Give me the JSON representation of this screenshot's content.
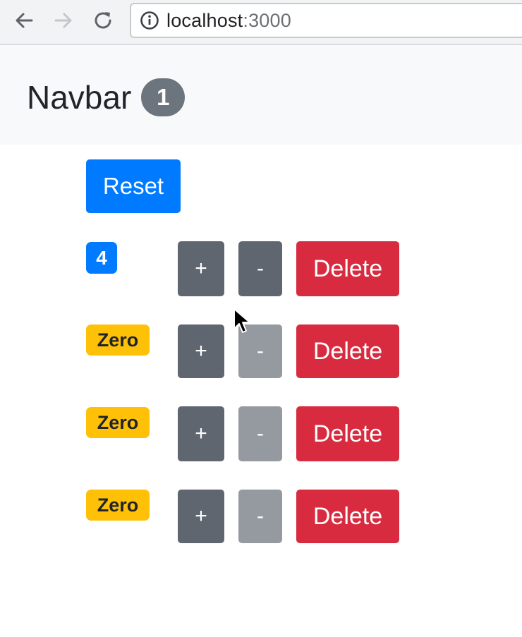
{
  "browser": {
    "url_host": "localhost",
    "url_port": ":3000",
    "icons": [
      "back-arrow-icon",
      "forward-arrow-icon",
      "reload-icon",
      "info-icon"
    ]
  },
  "navbar": {
    "brand": "Navbar",
    "total_count": "1"
  },
  "reset_label": "Reset",
  "counters": [
    {
      "badge": "4",
      "badge_variant": "primary",
      "increment_label": "+",
      "decrement_label": "-",
      "decrement_disabled": false,
      "delete_label": "Delete"
    },
    {
      "badge": "Zero",
      "badge_variant": "warning",
      "increment_label": "+",
      "decrement_label": "-",
      "decrement_disabled": true,
      "delete_label": "Delete"
    },
    {
      "badge": "Zero",
      "badge_variant": "warning",
      "increment_label": "+",
      "decrement_label": "-",
      "decrement_disabled": true,
      "delete_label": "Delete"
    },
    {
      "badge": "Zero",
      "badge_variant": "warning",
      "increment_label": "+",
      "decrement_label": "-",
      "decrement_disabled": true,
      "delete_label": "Delete"
    }
  ],
  "colors": {
    "primary": "#007bff",
    "secondary": "#6c757d",
    "danger": "#dc3545",
    "warning": "#ffc107",
    "navbar_bg": "#f8f9fa"
  }
}
